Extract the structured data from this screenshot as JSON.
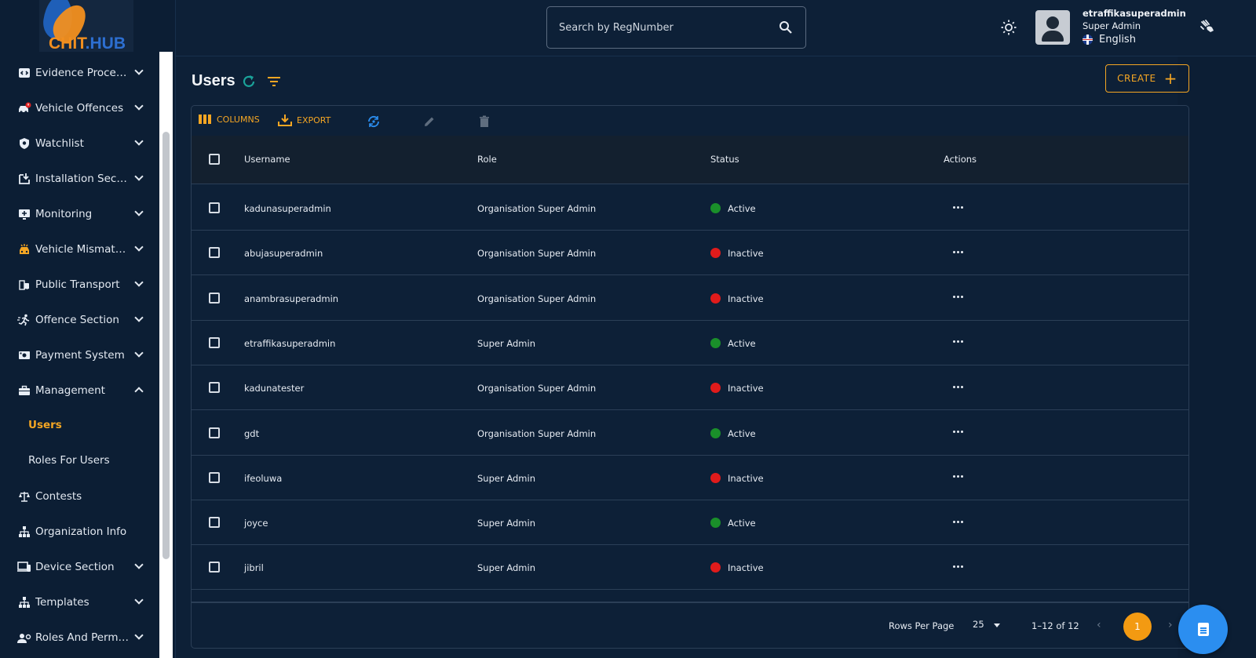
{
  "brand": {
    "logo_part1": "CHIT",
    "logo_part2": ".HUB"
  },
  "header": {
    "search_placeholder": "Search by RegNumber",
    "user_name": "etraffikasuperadmin",
    "user_role": "Super Admin",
    "language": "English"
  },
  "sidebar": {
    "items": [
      {
        "label": "Evidence Processi...",
        "icon": "evidence-icon"
      },
      {
        "label": "Vehicle Offences",
        "icon": "vehicle-offence-icon"
      },
      {
        "label": "Watchlist",
        "icon": "shield-icon"
      },
      {
        "label": "Installation Section",
        "icon": "install-icon"
      },
      {
        "label": "Monitoring",
        "icon": "monitor-icon"
      },
      {
        "label": "Vehicle Mismatch...",
        "icon": "vehicle-mismatch-icon"
      },
      {
        "label": "Public Transport",
        "icon": "transport-icon"
      },
      {
        "label": "Offence Section",
        "icon": "runner-icon"
      },
      {
        "label": "Payment System",
        "icon": "payment-icon"
      },
      {
        "label": "Management",
        "icon": "briefcase-icon"
      },
      {
        "label": "Contests",
        "icon": "scale-icon"
      },
      {
        "label": "Organization Info",
        "icon": "org-icon"
      },
      {
        "label": "Device Section",
        "icon": "device-icon"
      },
      {
        "label": "Templates",
        "icon": "templates-icon"
      },
      {
        "label": "Roles And Permis...",
        "icon": "roles-icon"
      }
    ],
    "sub_items": [
      {
        "label": "Users"
      },
      {
        "label": "Roles For Users"
      }
    ]
  },
  "main": {
    "title": "Users",
    "create_label": "CREATE",
    "toolbar": {
      "columns_label": "COLUMNS",
      "export_label": "EXPORT"
    },
    "table": {
      "columns": [
        "Username",
        "Role",
        "Status",
        "Actions"
      ],
      "rows": [
        {
          "username": "kadunasuperadmin",
          "role": "Organisation Super Admin",
          "status": "Active"
        },
        {
          "username": "abujasuperadmin",
          "role": "Organisation Super Admin",
          "status": "Inactive"
        },
        {
          "username": "anambrasuperadmin",
          "role": "Organisation Super Admin",
          "status": "Inactive"
        },
        {
          "username": "etraffikasuperadmin",
          "role": "Super Admin",
          "status": "Active"
        },
        {
          "username": "kadunatester",
          "role": "Organisation Super Admin",
          "status": "Inactive"
        },
        {
          "username": "gdt",
          "role": "Organisation Super Admin",
          "status": "Active"
        },
        {
          "username": "ifeoluwa",
          "role": "Super Admin",
          "status": "Inactive"
        },
        {
          "username": "joyce",
          "role": "Super Admin",
          "status": "Active"
        },
        {
          "username": "jibril",
          "role": "Super Admin",
          "status": "Inactive"
        }
      ]
    },
    "pagination": {
      "rows_per_page_label": "Rows Per Page",
      "rows_per_page": "25",
      "range": "1–12 of 12",
      "current_page": "1"
    }
  },
  "colors": {
    "accent": "#f5a623",
    "active": "#1a8f2a",
    "inactive": "#e01b1b",
    "fab": "#2b8ef0"
  }
}
